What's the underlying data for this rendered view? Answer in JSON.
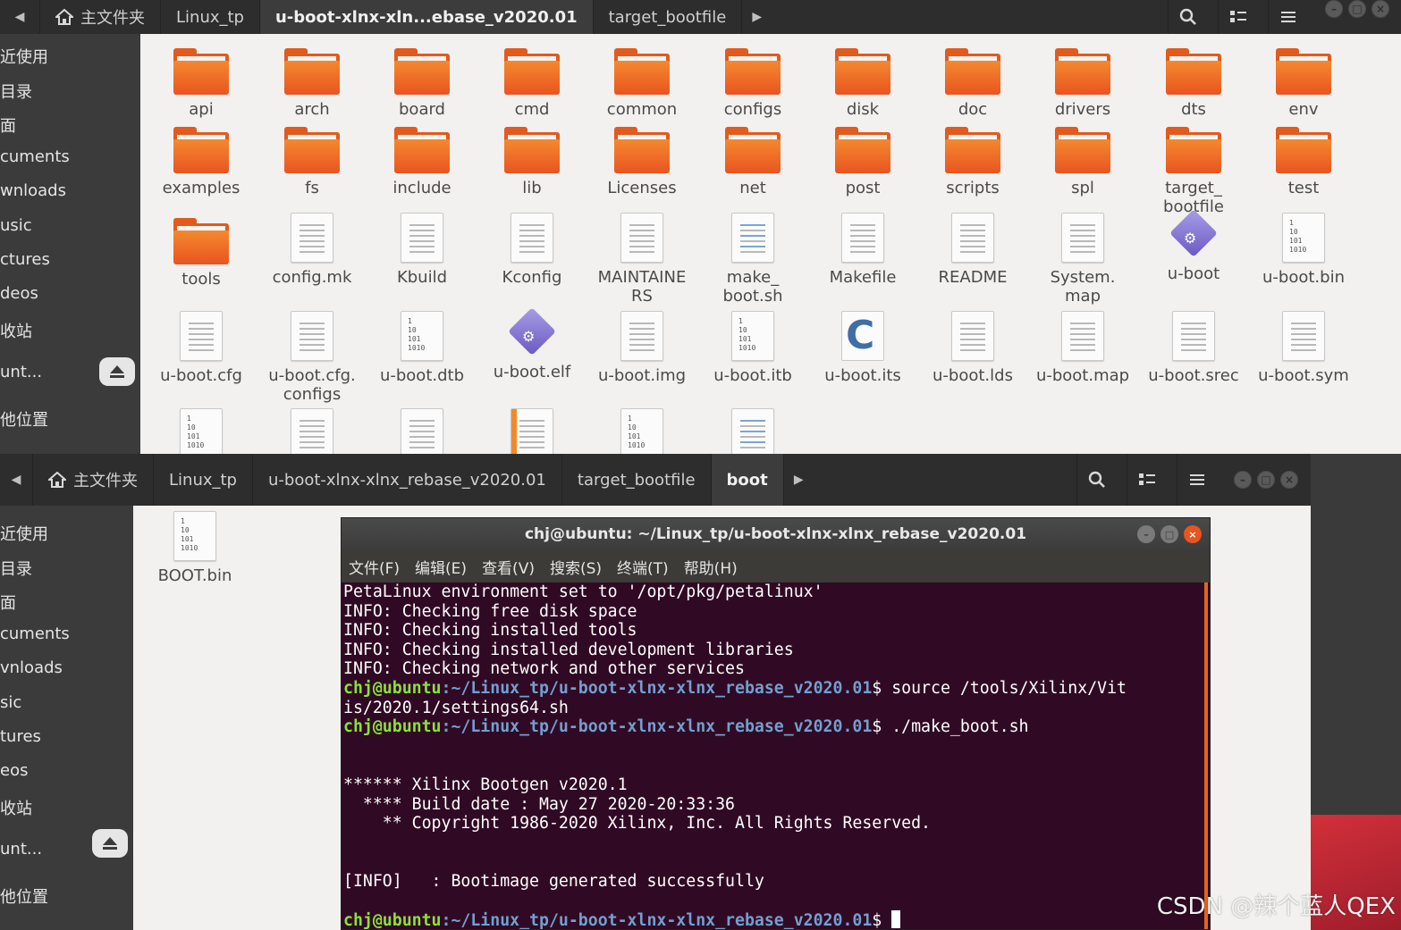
{
  "window1": {
    "breadcrumbs": [
      "主文件夹",
      "Linux_tp",
      "u-boot-xlnx-xln...ebase_v2020.01",
      "target_bootfile"
    ],
    "active_crumb": 2,
    "sidebar": [
      "近使用",
      "目录",
      "面",
      "cuments",
      "wnloads",
      "usic",
      "ctures",
      "deos",
      "收站",
      "unt...",
      "他位置"
    ],
    "files": [
      {
        "name": "api",
        "icon": "folder"
      },
      {
        "name": "arch",
        "icon": "folder"
      },
      {
        "name": "board",
        "icon": "folder"
      },
      {
        "name": "cmd",
        "icon": "folder"
      },
      {
        "name": "common",
        "icon": "folder"
      },
      {
        "name": "configs",
        "icon": "folder"
      },
      {
        "name": "disk",
        "icon": "folder"
      },
      {
        "name": "doc",
        "icon": "folder"
      },
      {
        "name": "drivers",
        "icon": "folder"
      },
      {
        "name": "dts",
        "icon": "folder"
      },
      {
        "name": "env",
        "icon": "folder"
      },
      {
        "name": "examples",
        "icon": "folder"
      },
      {
        "name": "fs",
        "icon": "folder"
      },
      {
        "name": "include",
        "icon": "folder"
      },
      {
        "name": "lib",
        "icon": "folder"
      },
      {
        "name": "Licenses",
        "icon": "folder"
      },
      {
        "name": "net",
        "icon": "folder"
      },
      {
        "name": "post",
        "icon": "folder"
      },
      {
        "name": "scripts",
        "icon": "folder"
      },
      {
        "name": "spl",
        "icon": "folder"
      },
      {
        "name": "target_\nbootfile",
        "icon": "folder"
      },
      {
        "name": "test",
        "icon": "folder"
      },
      {
        "name": "tools",
        "icon": "folder"
      },
      {
        "name": "config.mk",
        "icon": "text"
      },
      {
        "name": "Kbuild",
        "icon": "text"
      },
      {
        "name": "Kconfig",
        "icon": "text"
      },
      {
        "name": "MAINTAINE\nRS",
        "icon": "text"
      },
      {
        "name": "make_\nboot.sh",
        "icon": "script"
      },
      {
        "name": "Makefile",
        "icon": "text"
      },
      {
        "name": "README",
        "icon": "text"
      },
      {
        "name": "System.\nmap",
        "icon": "text"
      },
      {
        "name": "u-boot",
        "icon": "exec"
      },
      {
        "name": "u-boot.bin",
        "icon": "binary"
      },
      {
        "name": "u-boot.cfg",
        "icon": "text"
      },
      {
        "name": "u-boot.cfg.\nconfigs",
        "icon": "text"
      },
      {
        "name": "u-boot.dtb",
        "icon": "binary"
      },
      {
        "name": "u-boot.elf",
        "icon": "exec"
      },
      {
        "name": "u-boot.img",
        "icon": "text"
      },
      {
        "name": "u-boot.itb",
        "icon": "binary"
      },
      {
        "name": "u-boot.its",
        "icon": "c"
      },
      {
        "name": "u-boot.lds",
        "icon": "text"
      },
      {
        "name": "u-boot.map",
        "icon": "text"
      },
      {
        "name": "u-boot.srec",
        "icon": "text"
      },
      {
        "name": "u-boot.sym",
        "icon": "text"
      },
      {
        "name": "",
        "icon": "binary"
      },
      {
        "name": "",
        "icon": "text"
      },
      {
        "name": "",
        "icon": "text"
      },
      {
        "name": "",
        "icon": "orange"
      },
      {
        "name": "",
        "icon": "binary"
      },
      {
        "name": "",
        "icon": "script"
      }
    ]
  },
  "window2": {
    "breadcrumbs": [
      "主文件夹",
      "Linux_tp",
      "u-boot-xlnx-xlnx_rebase_v2020.01",
      "target_bootfile",
      "boot"
    ],
    "active_crumb": 4,
    "sidebar": [
      "近使用",
      "目录",
      "面",
      "cuments",
      "vnloads",
      "sic",
      "tures",
      "eos",
      "收站",
      "unt...",
      "他位置"
    ],
    "files": [
      {
        "name": "BOOT.bin",
        "icon": "binary"
      }
    ]
  },
  "binary_glyph": "1\n10\n101\n1010",
  "terminal": {
    "title": "chj@ubuntu: ~/Linux_tp/u-boot-xlnx-xlnx_rebase_v2020.01",
    "menu": [
      "文件(F)",
      "编辑(E)",
      "查看(V)",
      "搜索(S)",
      "终端(T)",
      "帮助(H)"
    ],
    "lines": [
      {
        "t": "PetaLinux environment set to '/opt/pkg/petalinux'"
      },
      {
        "t": "INFO: Checking free disk space"
      },
      {
        "t": "INFO: Checking installed tools"
      },
      {
        "t": "INFO: Checking installed development libraries"
      },
      {
        "t": "INFO: Checking network and other services"
      },
      {
        "user": "chj@ubuntu",
        "path": ":~/Linux_tp/u-boot-xlnx-xlnx_rebase_v2020.01",
        "cmd": "$ source /tools/Xilinx/Vit"
      },
      {
        "t": "is/2020.1/settings64.sh"
      },
      {
        "user": "chj@ubuntu",
        "path": ":~/Linux_tp/u-boot-xlnx-xlnx_rebase_v2020.01",
        "cmd": "$ ./make_boot.sh"
      },
      {
        "t": ""
      },
      {
        "t": ""
      },
      {
        "t": "****** Xilinx Bootgen v2020.1"
      },
      {
        "t": "  **** Build date : May 27 2020-20:33:36"
      },
      {
        "t": "    ** Copyright 1986-2020 Xilinx, Inc. All Rights Reserved."
      },
      {
        "t": ""
      },
      {
        "t": ""
      },
      {
        "t": "[INFO]   : Bootimage generated successfully"
      },
      {
        "t": ""
      },
      {
        "user": "chj@ubuntu",
        "path": ":~/Linux_tp/u-boot-xlnx-xlnx_rebase_v2020.01",
        "cmd": "$ ",
        "cursor": true
      }
    ]
  },
  "watermark": "CSDN @辣个蓝人QEX",
  "colors": {
    "ubuntu_orange": "#e95420",
    "terminal_bg": "#300a24",
    "prompt_green": "#8ae234",
    "prompt_blue": "#729fcf",
    "desktop_red": "#c4252e"
  }
}
